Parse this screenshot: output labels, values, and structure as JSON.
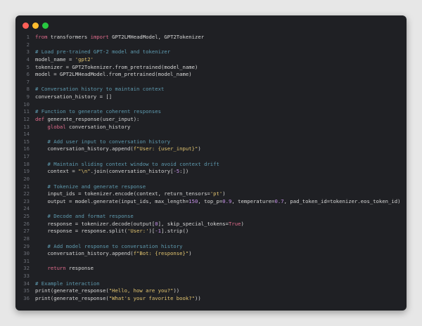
{
  "colors": {
    "page_background": "#e7e7e7",
    "window_background": "#1f2024",
    "close_dot": "#fe5f57",
    "minimize_dot": "#febc2e",
    "maximize_dot": "#28c840",
    "line_number": "#6b6e76",
    "keyword": "#e06c8c",
    "string": "#e2c46f",
    "comment": "#5f9bb0",
    "number": "#c792ea",
    "identifier": "#d7d7d7"
  },
  "code_lines": [
    {
      "num": "1",
      "tokens": [
        {
          "t": "from",
          "c": "kw"
        },
        {
          "t": " transformers ",
          "c": "id"
        },
        {
          "t": "import",
          "c": "kw"
        },
        {
          "t": " GPT2LMHeadModel, GPT2Tokenizer",
          "c": "id"
        }
      ]
    },
    {
      "num": "2",
      "tokens": []
    },
    {
      "num": "3",
      "tokens": [
        {
          "t": "# Load pre-trained GPT-2 model and tokenizer",
          "c": "com"
        }
      ]
    },
    {
      "num": "4",
      "tokens": [
        {
          "t": "model_name = ",
          "c": "id"
        },
        {
          "t": "'gpt2'",
          "c": "str"
        }
      ]
    },
    {
      "num": "5",
      "tokens": [
        {
          "t": "tokenizer = GPT2Tokenizer.from_pretrained(model_name)",
          "c": "id"
        }
      ]
    },
    {
      "num": "6",
      "tokens": [
        {
          "t": "model = GPT2LMHeadModel.from_pretrained(model_name)",
          "c": "id"
        }
      ]
    },
    {
      "num": "7",
      "tokens": []
    },
    {
      "num": "8",
      "tokens": [
        {
          "t": "# Conversation history to maintain context",
          "c": "com"
        }
      ]
    },
    {
      "num": "9",
      "tokens": [
        {
          "t": "conversation_history = []",
          "c": "id"
        }
      ]
    },
    {
      "num": "10",
      "tokens": []
    },
    {
      "num": "11",
      "tokens": [
        {
          "t": "# Function to generate coherent responses",
          "c": "com"
        }
      ]
    },
    {
      "num": "12",
      "tokens": [
        {
          "t": "def",
          "c": "kw"
        },
        {
          "t": " generate_response(user_input):",
          "c": "id"
        }
      ]
    },
    {
      "num": "13",
      "tokens": [
        {
          "t": "    ",
          "c": "id"
        },
        {
          "t": "global",
          "c": "kw"
        },
        {
          "t": " conversation_history",
          "c": "id"
        }
      ]
    },
    {
      "num": "14",
      "tokens": []
    },
    {
      "num": "15",
      "tokens": [
        {
          "t": "    ",
          "c": "id"
        },
        {
          "t": "# Add user input to conversation history",
          "c": "com"
        }
      ]
    },
    {
      "num": "16",
      "tokens": [
        {
          "t": "    conversation_history.append(",
          "c": "id"
        },
        {
          "t": "f\"User: {user_input}\"",
          "c": "str"
        },
        {
          "t": ")",
          "c": "id"
        }
      ]
    },
    {
      "num": "17",
      "tokens": []
    },
    {
      "num": "18",
      "tokens": [
        {
          "t": "    ",
          "c": "id"
        },
        {
          "t": "# Maintain sliding context window to avoid context drift",
          "c": "com"
        }
      ]
    },
    {
      "num": "19",
      "tokens": [
        {
          "t": "    context = ",
          "c": "id"
        },
        {
          "t": "\"\\n\"",
          "c": "str"
        },
        {
          "t": ".join(conversation_history[",
          "c": "id"
        },
        {
          "t": "-5",
          "c": "num"
        },
        {
          "t": ":])",
          "c": "id"
        }
      ]
    },
    {
      "num": "20",
      "tokens": []
    },
    {
      "num": "21",
      "tokens": [
        {
          "t": "    ",
          "c": "id"
        },
        {
          "t": "# Tokenize and generate response",
          "c": "com"
        }
      ]
    },
    {
      "num": "22",
      "tokens": [
        {
          "t": "    input_ids = tokenizer.encode(context, return_tensors=",
          "c": "id"
        },
        {
          "t": "'pt'",
          "c": "str"
        },
        {
          "t": ")",
          "c": "id"
        }
      ]
    },
    {
      "num": "23",
      "tokens": [
        {
          "t": "    output = model.generate(input_ids, max_length=",
          "c": "id"
        },
        {
          "t": "150",
          "c": "num"
        },
        {
          "t": ", top_p=",
          "c": "id"
        },
        {
          "t": "0.9",
          "c": "num"
        },
        {
          "t": ", temperature=",
          "c": "id"
        },
        {
          "t": "0.7",
          "c": "num"
        },
        {
          "t": ", pad_token_id=tokenizer.eos_token_id)",
          "c": "id"
        }
      ]
    },
    {
      "num": "24",
      "tokens": []
    },
    {
      "num": "25",
      "tokens": [
        {
          "t": "    ",
          "c": "id"
        },
        {
          "t": "# Decode and format response",
          "c": "com"
        }
      ]
    },
    {
      "num": "26",
      "tokens": [
        {
          "t": "    response = tokenizer.decode(output[",
          "c": "id"
        },
        {
          "t": "0",
          "c": "num"
        },
        {
          "t": "], skip_special_tokens=",
          "c": "id"
        },
        {
          "t": "True",
          "c": "kw"
        },
        {
          "t": ")",
          "c": "id"
        }
      ]
    },
    {
      "num": "27",
      "tokens": [
        {
          "t": "    response = response.split(",
          "c": "id"
        },
        {
          "t": "'User:'",
          "c": "str"
        },
        {
          "t": ")[",
          "c": "id"
        },
        {
          "t": "-1",
          "c": "num"
        },
        {
          "t": "].strip()",
          "c": "id"
        }
      ]
    },
    {
      "num": "28",
      "tokens": []
    },
    {
      "num": "29",
      "tokens": [
        {
          "t": "    ",
          "c": "id"
        },
        {
          "t": "# Add model response to conversation history",
          "c": "com"
        }
      ]
    },
    {
      "num": "30",
      "tokens": [
        {
          "t": "    conversation_history.append(",
          "c": "id"
        },
        {
          "t": "f\"Bot: {response}\"",
          "c": "str"
        },
        {
          "t": ")",
          "c": "id"
        }
      ]
    },
    {
      "num": "31",
      "tokens": []
    },
    {
      "num": "32",
      "tokens": [
        {
          "t": "    ",
          "c": "id"
        },
        {
          "t": "return",
          "c": "kw"
        },
        {
          "t": " response",
          "c": "id"
        }
      ]
    },
    {
      "num": "33",
      "tokens": []
    },
    {
      "num": "34",
      "tokens": [
        {
          "t": "# Example interaction",
          "c": "com"
        }
      ]
    },
    {
      "num": "35",
      "tokens": [
        {
          "t": "print(generate_response(",
          "c": "id"
        },
        {
          "t": "\"Hello, how are you?\"",
          "c": "str"
        },
        {
          "t": "))",
          "c": "id"
        }
      ]
    },
    {
      "num": "36",
      "tokens": [
        {
          "t": "print(generate_response(",
          "c": "id"
        },
        {
          "t": "\"What's your favorite book?\"",
          "c": "str"
        },
        {
          "t": "))",
          "c": "id"
        }
      ]
    }
  ]
}
